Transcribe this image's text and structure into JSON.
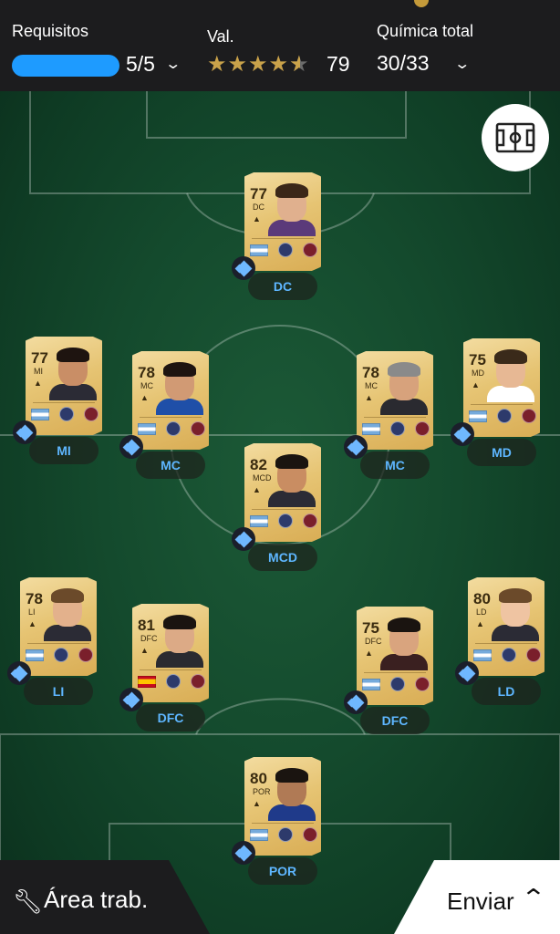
{
  "header": {
    "requirements_label": "Requisitos",
    "requirements_value": "5/5",
    "requirements_progress": 1.0,
    "rating_label": "Val.",
    "rating_stars": 4.5,
    "rating_value": "79",
    "chemistry_label": "Química total",
    "chemistry_value": "30/33"
  },
  "players": [
    {
      "id": "dc",
      "rating": "77",
      "position_card": "DC",
      "position_label": "DC",
      "flag": "ar",
      "hair": "#3b2718",
      "skin": "#e0b08e",
      "shirt": "#5b3a7a"
    },
    {
      "id": "mi",
      "rating": "77",
      "position_card": "MI",
      "position_label": "MI",
      "flag": "ar",
      "hair": "#1e1410",
      "skin": "#c98e66",
      "shirt": "#2b2b35"
    },
    {
      "id": "mc1",
      "rating": "78",
      "position_card": "MC",
      "position_label": "MC",
      "flag": "ar",
      "hair": "#1e1410",
      "skin": "#d19a74",
      "shirt": "#1f4fa8"
    },
    {
      "id": "mc2",
      "rating": "78",
      "position_card": "MC",
      "position_label": "MC",
      "flag": "ar",
      "hair": "#8a8a8a",
      "skin": "#d7a27c",
      "shirt": "#2a2a30"
    },
    {
      "id": "md",
      "rating": "75",
      "position_card": "MD",
      "position_label": "MD",
      "flag": "ar",
      "hair": "#3a2a1a",
      "skin": "#e7b894",
      "shirt": "#ffffff"
    },
    {
      "id": "mcd",
      "rating": "82",
      "position_card": "MCD",
      "position_label": "MCD",
      "flag": "ar",
      "hair": "#1a1410",
      "skin": "#c98d62",
      "shirt": "#2b2b35"
    },
    {
      "id": "li",
      "rating": "78",
      "position_card": "LI",
      "position_label": "LI",
      "flag": "ar",
      "hair": "#6b4a2a",
      "skin": "#e3b18c",
      "shirt": "#2b2b35"
    },
    {
      "id": "dfc1",
      "rating": "81",
      "position_card": "DFC",
      "position_label": "DFC",
      "flag": "es",
      "hair": "#1a1410",
      "skin": "#dcaa86",
      "shirt": "#2a2a30"
    },
    {
      "id": "dfc2",
      "rating": "75",
      "position_card": "DFC",
      "position_label": "DFC",
      "flag": "ar",
      "hair": "#1a1410",
      "skin": "#d9a47e",
      "shirt": "#3a2020"
    },
    {
      "id": "ld",
      "rating": "80",
      "position_card": "LD",
      "position_label": "LD",
      "flag": "ar",
      "hair": "#6b4a2a",
      "skin": "#efc4a2",
      "shirt": "#2b2b35"
    },
    {
      "id": "por",
      "rating": "80",
      "position_card": "POR",
      "position_label": "POR",
      "flag": "ar",
      "hair": "#1a1410",
      "skin": "#b07a55",
      "shirt": "#1f3a8a"
    }
  ],
  "footer": {
    "workspace_label": "Área trab.",
    "send_label": "Enviar"
  },
  "colors": {
    "accent": "#1e9bff",
    "position_text": "#5eb6ff",
    "card_gold": "#e6c473",
    "header_bg": "#1c1c1e"
  },
  "icons": [
    "chevron-down-icon",
    "star-icon",
    "formation-icon",
    "chemistry-diamond-icon",
    "wrench-icon",
    "chevron-up-icon"
  ]
}
